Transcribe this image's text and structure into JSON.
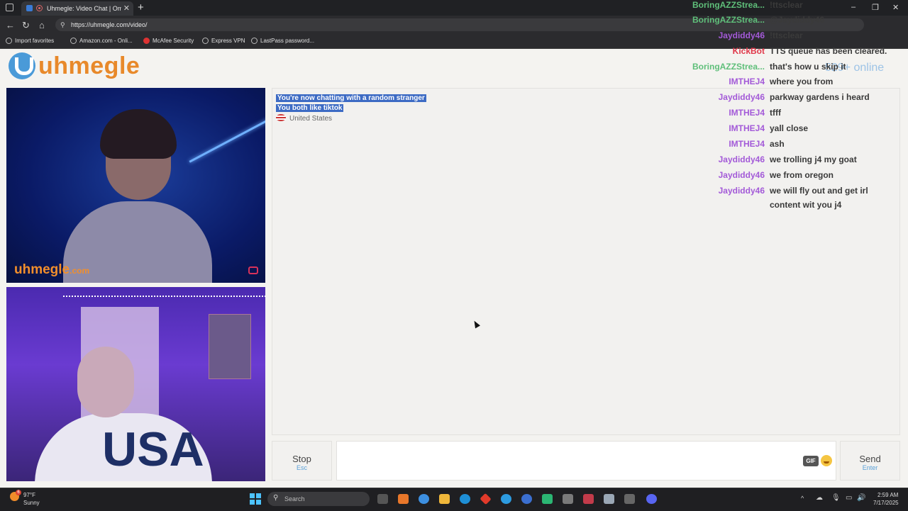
{
  "browser": {
    "tab_title": "Uhmegle: Video Chat | Omeg",
    "new_tab": "+",
    "url": "https://uhmegle.com/video/",
    "window_controls": [
      "–",
      "❐",
      "✕"
    ],
    "favorites": [
      "Import favorites",
      "Amazon.com - Onli...",
      "McAfee Security",
      "Express VPN",
      "LastPass password..."
    ]
  },
  "site": {
    "logo": "uhmegle",
    "online_count": "529+ online",
    "watermark": "uhmegle",
    "watermark_suffix": ".com"
  },
  "chat": {
    "system_messages": [
      "You're now chatting with a random stranger",
      "You both like tiktok"
    ],
    "country": "United States"
  },
  "overlay_chat": [
    {
      "user": "BoringAZZStrea...",
      "text": "!ttsclear",
      "color": "#5fbf7a"
    },
    {
      "user": "BoringAZZStrea...",
      "text": "@Jaydiddy46",
      "color": "#5fbf7a"
    },
    {
      "user": "Jaydiddy46",
      "text": "!ttsclear",
      "color": "#a35ad8"
    },
    {
      "user": "KickBot",
      "text": "TTS queue has been cleared.",
      "color": "#e0384a"
    },
    {
      "user": "BoringAZZStrea...",
      "text": "that's how u skip it",
      "color": "#5fbf7a"
    },
    {
      "user": "IMTHEJ4",
      "text": "where you from",
      "color": "#a35ad8"
    },
    {
      "user": "Jaydiddy46",
      "text": "parkway gardens i heard",
      "color": "#a35ad8"
    },
    {
      "user": "IMTHEJ4",
      "text": "tfff",
      "color": "#a35ad8"
    },
    {
      "user": "IMTHEJ4",
      "text": "yall close",
      "color": "#a35ad8"
    },
    {
      "user": "IMTHEJ4",
      "text": "ash",
      "color": "#a35ad8"
    },
    {
      "user": "Jaydiddy46",
      "text": "we trolling j4 my goat",
      "color": "#a35ad8"
    },
    {
      "user": "Jaydiddy46",
      "text": "we from oregon",
      "color": "#a35ad8"
    },
    {
      "user": "Jaydiddy46",
      "text": "we will fly out and get irl",
      "text2": "content wit you j4",
      "color": "#a35ad8"
    }
  ],
  "controls": {
    "stop_label": "Stop",
    "stop_hint": "Esc",
    "send_label": "Send",
    "send_hint": "Enter",
    "gif_label": "GIF"
  },
  "taskbar": {
    "weather_badge": "6",
    "weather_temp": "97°F",
    "weather_desc": "Sunny",
    "search_placeholder": "Search",
    "time": "2:59 AM",
    "date": "7/17/2025"
  }
}
